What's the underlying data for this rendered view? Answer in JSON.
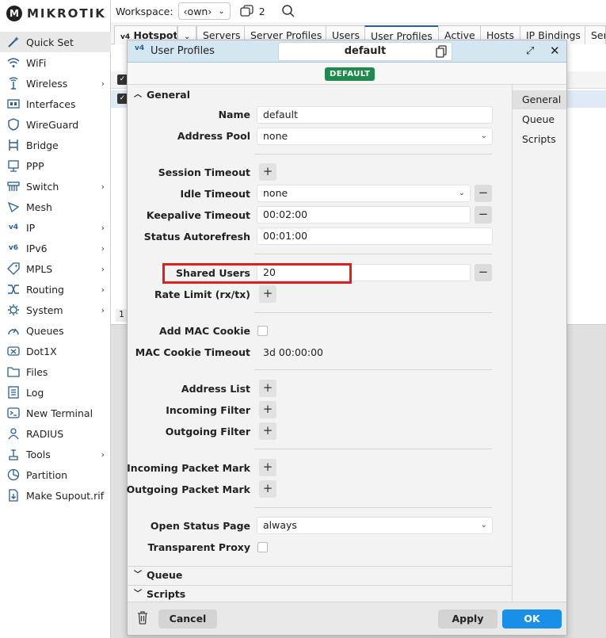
{
  "brand": {
    "name": "MIKROTIK"
  },
  "sidebar": {
    "items": [
      {
        "label": "Quick Set",
        "icon": "wand-icon",
        "chevron": false,
        "active": true
      },
      {
        "label": "WiFi",
        "icon": "wifi-icon",
        "chevron": false
      },
      {
        "label": "Wireless",
        "icon": "wireless-icon",
        "chevron": true
      },
      {
        "label": "Interfaces",
        "icon": "interfaces-icon",
        "chevron": false
      },
      {
        "label": "WireGuard",
        "icon": "wireguard-icon",
        "chevron": false
      },
      {
        "label": "Bridge",
        "icon": "bridge-icon",
        "chevron": false
      },
      {
        "label": "PPP",
        "icon": "ppp-icon",
        "chevron": false
      },
      {
        "label": "Switch",
        "icon": "switch-icon",
        "chevron": true
      },
      {
        "label": "Mesh",
        "icon": "mesh-icon",
        "chevron": false
      },
      {
        "label": "IP",
        "icon": "ip-icon",
        "chevron": true
      },
      {
        "label": "IPv6",
        "icon": "ipv6-icon",
        "chevron": true
      },
      {
        "label": "MPLS",
        "icon": "mpls-icon",
        "chevron": true
      },
      {
        "label": "Routing",
        "icon": "routing-icon",
        "chevron": true
      },
      {
        "label": "System",
        "icon": "system-icon",
        "chevron": true
      },
      {
        "label": "Queues",
        "icon": "queues-icon",
        "chevron": false
      },
      {
        "label": "Dot1X",
        "icon": "dot1x-icon",
        "chevron": false
      },
      {
        "label": "Files",
        "icon": "files-icon",
        "chevron": false
      },
      {
        "label": "Log",
        "icon": "log-icon",
        "chevron": false
      },
      {
        "label": "New Terminal",
        "icon": "terminal-icon",
        "chevron": false
      },
      {
        "label": "RADIUS",
        "icon": "radius-icon",
        "chevron": false
      },
      {
        "label": "Tools",
        "icon": "tools-icon",
        "chevron": true
      },
      {
        "label": "Partition",
        "icon": "partition-icon",
        "chevron": false
      },
      {
        "label": "Make Supout.rif",
        "icon": "supout-icon",
        "chevron": false
      }
    ]
  },
  "topbar": {
    "workspace_label": "Workspace:",
    "workspace_value": "‹own›",
    "windows_count": "2"
  },
  "tabs": [
    {
      "label": "Hotspot",
      "prefix": "v4"
    },
    {
      "label": "Servers"
    },
    {
      "label": "Server Profiles"
    },
    {
      "label": "Users"
    },
    {
      "label": "User Profiles",
      "active": true
    },
    {
      "label": "Active"
    },
    {
      "label": "Hosts"
    },
    {
      "label": "IP Bindings"
    },
    {
      "label": "Ser"
    }
  ],
  "background": {
    "count_text": "1"
  },
  "dialog": {
    "title": "User Profiles",
    "title_prefix": "v4",
    "name_value": "default",
    "badge": "DEFAULT",
    "sections": {
      "general": "General",
      "queue": "Queue",
      "scripts": "Scripts"
    },
    "right_nav": [
      "General",
      "Queue",
      "Scripts"
    ],
    "fields": {
      "name": {
        "label": "Name",
        "value": "default"
      },
      "address_pool": {
        "label": "Address Pool",
        "value": "none"
      },
      "session_timeout": {
        "label": "Session Timeout"
      },
      "idle_timeout": {
        "label": "Idle Timeout",
        "value": "none"
      },
      "keepalive_timeout": {
        "label": "Keepalive Timeout",
        "value": "00:02:00"
      },
      "status_autorefresh": {
        "label": "Status Autorefresh",
        "value": "00:01:00"
      },
      "shared_users": {
        "label": "Shared Users",
        "value": "20"
      },
      "rate_limit": {
        "label": "Rate Limit (rx/tx)"
      },
      "add_mac_cookie": {
        "label": "Add MAC Cookie",
        "checked": false
      },
      "mac_cookie_timeout": {
        "label": "MAC Cookie Timeout",
        "value": "3d 00:00:00"
      },
      "address_list": {
        "label": "Address List"
      },
      "incoming_filter": {
        "label": "Incoming Filter"
      },
      "outgoing_filter": {
        "label": "Outgoing Filter"
      },
      "incoming_packet_mark": {
        "label": "Incoming Packet Mark"
      },
      "outgoing_packet_mark": {
        "label": "Outgoing Packet Mark"
      },
      "open_status_page": {
        "label": "Open Status Page",
        "value": "always"
      },
      "transparent_proxy": {
        "label": "Transparent Proxy",
        "checked": false
      }
    },
    "buttons": {
      "cancel": "Cancel",
      "apply": "Apply",
      "ok": "OK"
    }
  },
  "colors": {
    "accent": "#2a5f8f",
    "ok_button": "#1a8fe8",
    "badge": "#1f8a4c",
    "highlight": "#dd1f1f"
  }
}
